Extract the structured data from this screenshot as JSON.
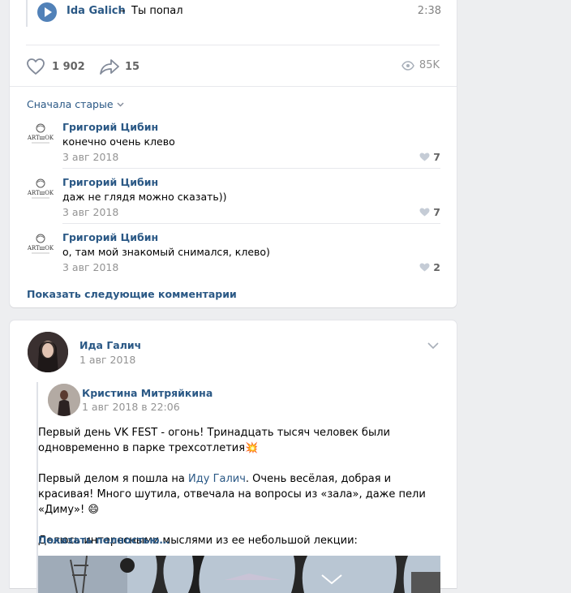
{
  "audio": {
    "artist": "Ida Galich",
    "dash": "–",
    "title": "Ты попал",
    "duration": "2:38"
  },
  "post_actions": {
    "likes": "1 902",
    "shares": "15",
    "views": "85K"
  },
  "comments_sort": "Сначала старые",
  "comments": [
    {
      "author": "Григорий Цибин",
      "text": "конечно очень клево",
      "date": "3 авг 2018",
      "likes": "7"
    },
    {
      "author": "Григорий Цибин",
      "text": "даж не глядя можно сказать))",
      "date": "3 авг 2018",
      "likes": "7"
    },
    {
      "author": "Григорий Цибин",
      "text": "о, там мой знакомый снимался, клево)",
      "date": "3 авг 2018",
      "likes": "2"
    }
  ],
  "show_more_comments": "Показать следующие комментарии",
  "post2": {
    "author": "Ида Галич",
    "date": "1 авг 2018",
    "repost": {
      "author": "Кристина Митряйкина",
      "date": "1 авг 2018 в 22:06",
      "p1": "Первый день VK FEST - огонь! Тринадцать тысяч человек были одновременно в парке трехсотлетия",
      "p1_emoji": "💥",
      "p2_before": "Первый делом я пошла на ",
      "p2_link": "Иду Галич",
      "p2_after": ". Очень весёлая, добрая и красивая! Много шутила, отвечала на вопросы из «зала», даже пели «Диму»! ",
      "p2_emoji": "😄",
      "p3": "Делюсь интересными мыслями из ее небольшой лекции:",
      "show_full": "Показать полностью…"
    }
  }
}
